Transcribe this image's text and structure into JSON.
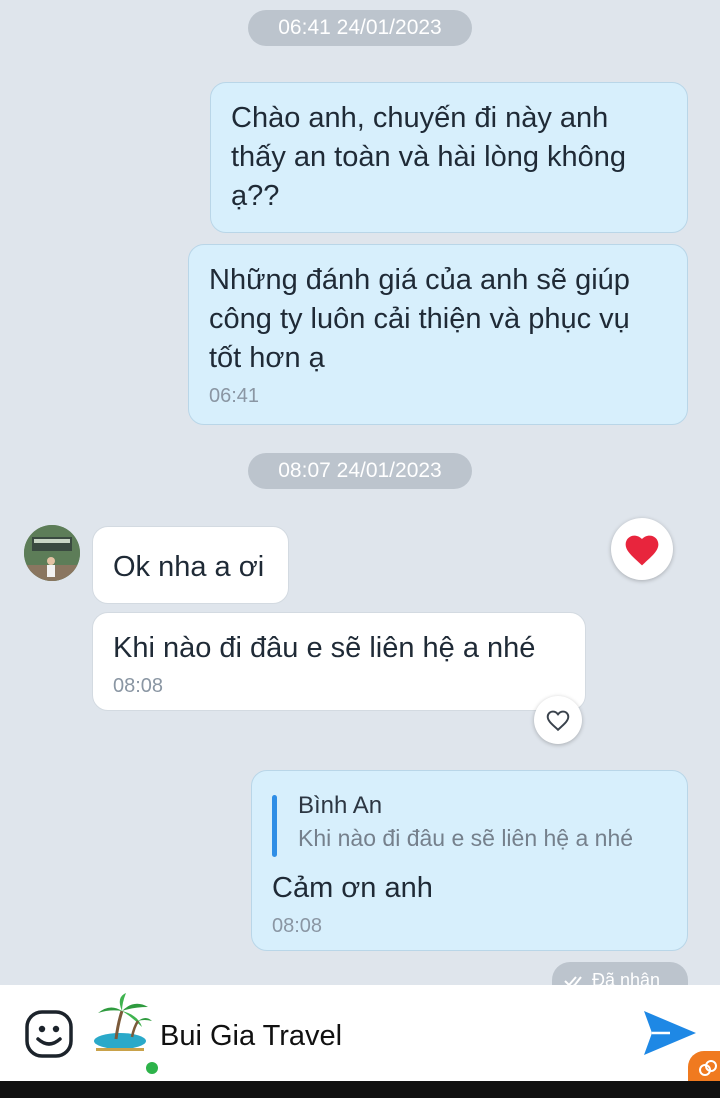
{
  "timestamps": [
    "06:41 24/01/2023",
    "08:07 24/01/2023"
  ],
  "messages": {
    "m1": {
      "text": "Chào anh, chuyến đi này anh thấy an toàn và hài lòng không ạ??"
    },
    "m2": {
      "text": "Những đánh giá của anh sẽ giúp công ty luôn cải thiện và phục vụ tốt hơn ạ",
      "time": "06:41"
    },
    "m3": {
      "text": "Ok nha a ơi"
    },
    "m4": {
      "text": "Khi nào đi đâu e sẽ liên hệ a nhé",
      "time": "08:08"
    },
    "m5": {
      "quote_name": "Bình An",
      "quote_text": "Khi nào đi đâu e sẽ liên hệ a nhé",
      "text": "Cảm ơn anh",
      "time": "08:08"
    }
  },
  "status": "Đã nhận",
  "bottom": {
    "title": "Bui Gia Travel"
  },
  "colors": {
    "accent": "#2f8ee6",
    "send": "#1e88e5",
    "heart": "#e8253d",
    "online": "#2db34a"
  },
  "icons": [
    "sticker-icon",
    "heart-icon",
    "heart-outline-icon",
    "double-check-icon",
    "send-icon",
    "palm-logo-icon"
  ]
}
